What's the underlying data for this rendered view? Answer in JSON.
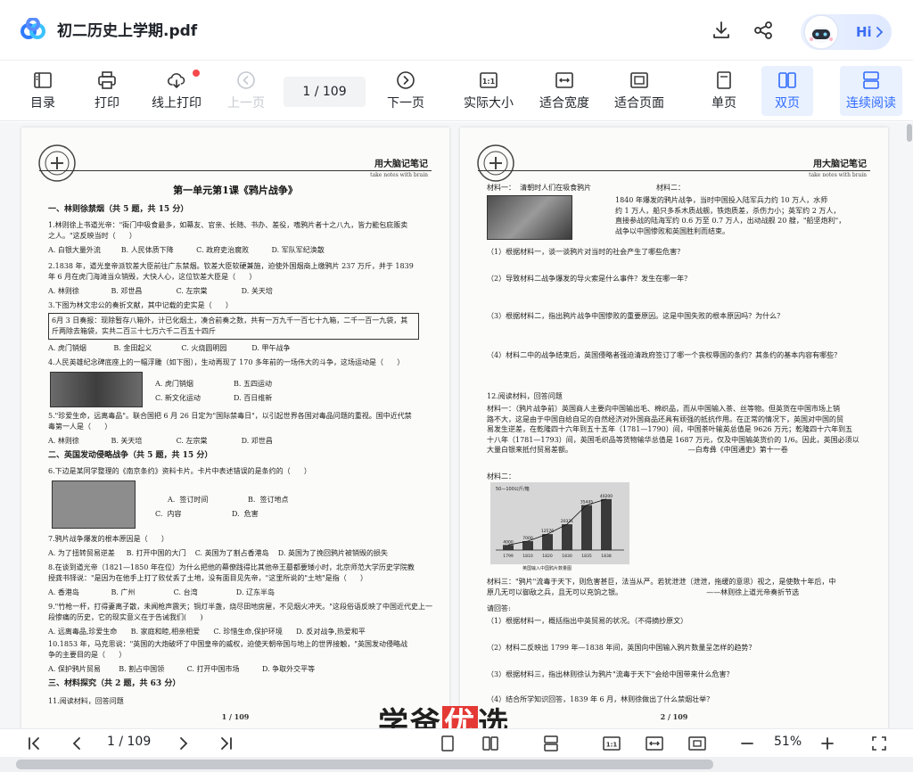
{
  "window": {
    "title": "初二历史上学期.pdf"
  },
  "assistant": {
    "label": "Hi"
  },
  "toolbar": {
    "toc": "目录",
    "print": "打印",
    "online_print": "线上打印",
    "prev": "上一页",
    "page_indicator": "1  / 109",
    "next": "下一页",
    "actual_size": "实际大小",
    "fit_width": "适合宽度",
    "fit_page": "适合页面",
    "single": "单页",
    "double": "双页",
    "continuous": "连续阅读"
  },
  "left_page": {
    "header_cn": "用大脑记笔记",
    "header_en": "take notes with brain",
    "title": "第一单元第1课《鸦片战争》",
    "s1": "一、林则徐禁烟（共 5 题，共 15 分）",
    "q1": "1.林则徐上书道光帝：\"衙门中吸食最多，如幕友、官亲、长随、书办、差役，嗜鸦片者十之八九，皆力能包庇贩卖\n之人。\"这反映当时（      ）",
    "q1o": "A. 白银大量外流         B. 人民体质下降          C. 政府吏治腐败          D. 军队军纪涣散",
    "q2": "2.1838 年，道光皇帝派钦差大臣前往广东禁烟。钦差大臣软硬兼施，迫使外国烟商上缴鸦片 237 万斤，并于 1839\n年 6 月在虎门海滩当众销毁，大快人心，这位钦差大臣是（      ）",
    "q2o": "A. 林则徐              B. 邓世昌               C. 左宗棠               D. 关天培",
    "q3": "3.下图为林文忠公的奏折文献，其中记载的史实是（      ）",
    "q3box": "6月 3 日奏报：现除暂存八箱外，计已化烟土，凑合前奏之数，共有一万九千一百七十九箱，二千一百一九袋，其\n斤两除去箱袋，实共二百三十七万六千二百五十四斤",
    "q3o": "A. 虎门销烟            B. 金田起义             C. 火烧圆明园           D. 甲午战争",
    "q4": "4.人民英雄纪念碑底座上的一幅浮雕（如下图），生动再现了 170 多年前的一场伟大的斗争，这场运动是（      ）",
    "q4a": "A. 虎门销烟",
    "q4b": "B. 五四运动",
    "q4c": "C. 新文化运动",
    "q4d": "D. 百日维新",
    "q5": "5.\"珍爱生命，远离毒品\"。联合国把 6 月 26 日定为\"国际禁毒日\"，以引起世界各国对毒品问题的重视。国中近代禁\n毒第一人是（      ）",
    "q5o": "A. 林则徐              B. 关天培               C. 左宗棠               D. 邓世昌",
    "s2": "二、英国发动侵略战争（共 5 题，共 15 分）",
    "q6": "6.下边是某同学整理的《南京条约》资料卡片。卡片中表述错误的是条约的（      ）",
    "q6a": "A.  签订时间",
    "q6b": "B.  签订地点",
    "q6c": "C.  内容",
    "q6d": "D.  危害",
    "q7": "7.鸦片战争爆发的根本原因是（      ）",
    "q7o": "A. 为了扭转贸易逆差     B. 打开中国的大门    C. 英国为了割占香港岛    D. 英国为了挽回鸦片被销毁的损失",
    "q8": "8.在谈到道光帝（1821—1850 年在位）为什么把他的幕僚践得比其他帝王墓都要矮小时，北京师范大学历史学院教\n授龚书铎说：\"是因为在他手上打了败仗丢了土地，没有面目见先帝，\"这里所说的\"土地\"是指（      ）",
    "q8o": "A. 香港岛              B. 广州                 C. 台湾                 D. 辽东半岛",
    "q9": "9.\"竹枪一杆，打得妻离子散，未闻枪声震天；铜灯半盏，烧尽田地房屋，不见烟火冲天。\"这段俗语反映了中国近代史上一\n段惨痛的历史，它的现实意义在于告诫我们(      )",
    "q9o": "A. 远离毒品,珍爱生命      B. 家庭和睦,相亲相爱      C. 珍惜生命,保护环境      D. 反对战争,热爱和平",
    "q10": "10.1853 年，马克思说：\"英国的大炮破坏了中国皇帝的威权，迫使天朝帝国与地上的世界接触，\"英国发动侵略战\n争的主要目的是（      ）",
    "q10o": "A. 保护鸦片贸易        B. 割占中国领          C. 打开中国市场          D. 争取外交平等",
    "s3": "三、材料探究（共 2 题，共 63 分）",
    "q11": "11.阅读材料，回答问题",
    "page_num": "1 / 109"
  },
  "right_page": {
    "header_cn": "用大脑记笔记",
    "header_en": "take notes with brain",
    "m1": "材料一：  清朝时人们在吸食鸦片",
    "m2": "材料二：",
    "m2t": "1840 年爆发的鸦片战争，当时中国投入陆军兵力约 10 万人，水师\n约 1 万人，船只多系木质战舰，铁炮质差，杀伤力小；英军约 2 万人，\n直接参战的陆海军约 0.6 万至 0.7 万人，出动战舰 20 艘，\"船坚炮利\"，\n战争以中国惨败和英国胜利而结束。",
    "r1": "（1）根据材料一，谈一谈鸦片对当时的社会产生了哪些危害？",
    "r2": "（2）导致材料二战争爆发的导火索是什么事件？发生在哪一年？",
    "r3": "（3）根据材料二，指出鸦片战争中国惨败的重要原因。这是中国失败的根本原因吗？为什么？",
    "r4": "（4）材料二中的战争结束后，英国侵略者强迫清政府签订了哪一个丧权辱国的条约？其条约的基本内容有哪些？",
    "q12": "12.阅读材料，回答问题",
    "q12m1": "材料一：（鸦片战争前）英国商人主要向中国输出毛、棉织品，而从中国输入茶、丝等物。但英货在中国市场上销\n路不大，这是由于中国自给自足的自然经济对外国商品还具有顽强的抵抗作用。在正常的情况下，英国对中国的贸\n易发生逆差，在乾隆四十六年到五十五年（1781—1790）间，中国茶叶输英总值是 9626 万元；乾隆四十六年到五\n十八年（1781—1793）间，英国毛织品等货物输华总值是 1687 万元，仅及中国输英货价的 1/6。因此，英国必须以\n大量白银来抵付贸易差额。                                                   —白寿彝《中国通史》第十一卷",
    "q12m2": "材料二：",
    "q12m3": "材料三：\"鸦片\"流毒于天下，则危害甚巨，法当从严。若犹泄泄（泄泄，拖缓的意思）视之，是使数十年后，中\n原几无可以御敌之兵，且无可以充饷之银。                                     ——林则徐上道光帝奏折节选",
    "ask": "请回答:",
    "a1": "（1）根据材料一，概括指出中英贸易的状况。（不得摘抄原文）",
    "a2": "（2）材料二反映出 1799 年—1838 年间，英国向中国输入鸦片数量呈怎样的趋势？",
    "a3": "（3）根据材料三，指出林则徐认为鸦片\"流毒于天下\"会给中国带来什么危害？",
    "a4": "（4）结合所学知识回答，1839 年 6 月，林则徐做出了什么禁烟壮举？",
    "page_num": "2 / 109"
  },
  "chart_data": {
    "type": "bar",
    "title": "英国输入中国鸦片数量图",
    "ylabel": "50—100公斤/箱",
    "categories": [
      "1799",
      "1810",
      "1820",
      "1830",
      "1835",
      "1838"
    ],
    "values": [
      4000,
      7000,
      12576,
      20331,
      35445,
      40200
    ],
    "ylim": [
      0,
      45000
    ],
    "grid": false,
    "legend": "none"
  },
  "watermark": {
    "prefix": "学爸",
    "highlight": "优",
    "suffix": "选"
  },
  "bottom": {
    "page_indicator": "1  / 109",
    "zoom": "51%"
  },
  "colors": {
    "accent": "#2f6bff",
    "active_bg": "#e9f1ff",
    "badge": "#f5494c"
  }
}
